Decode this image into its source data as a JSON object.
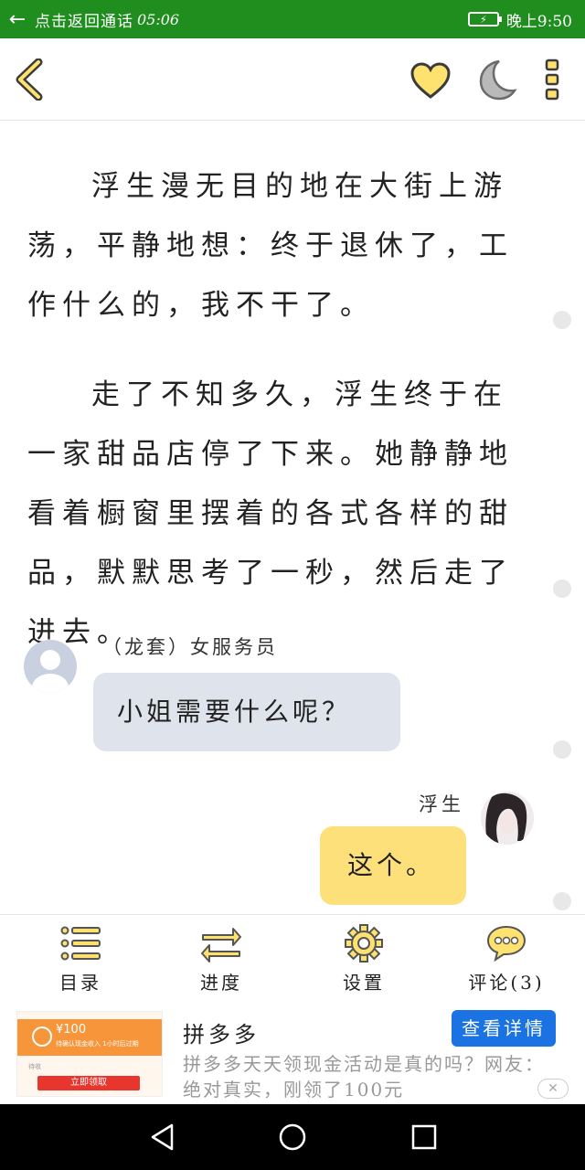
{
  "status_bar": {
    "return_hint": "点击返回通话",
    "call_time": "05:06",
    "clock": "晚上9:50",
    "background_color": "#1f8e1f"
  },
  "toolbar": {
    "icons": [
      "back-chevron-icon",
      "heart-icon",
      "moon-icon",
      "more-vertical-icon"
    ],
    "accent_color": "#fde26f"
  },
  "story": {
    "paragraphs": [
      "浮生漫无目的地在大街上游荡，平静地想：终于退休了，工作什么的，我不干了。",
      "走了不知多久，浮生终于在一家甜品店停了下来。她静静地看着橱窗里摆着的各式各样的甜品，默默思考了一秒，然后走了进去。"
    ]
  },
  "chat": {
    "left": {
      "name": "（龙套）女服务员",
      "message": "小姐需要什么呢？"
    },
    "right": {
      "name": "浮生",
      "message": "这个。"
    }
  },
  "bottom_menu": {
    "items": [
      {
        "label": "目录",
        "icon": "list-icon"
      },
      {
        "label": "进度",
        "icon": "swap-arrows-icon"
      },
      {
        "label": "设置",
        "icon": "gear-icon"
      },
      {
        "label": "评论(3)",
        "icon": "comment-bubble-icon"
      }
    ]
  },
  "ad": {
    "image": {
      "amount": "¥100",
      "subtitle": "待确认现金收入 1小时后过期",
      "note": "待收",
      "button": "立即领取"
    },
    "title": "拼多多",
    "description": "拼多多天天领现金活动是真的吗？网友：绝对真实，刚领了100元",
    "cta": "查看详情",
    "close": "✕",
    "cta_color": "#1b73e3"
  },
  "nav_bar": {
    "icons": [
      "back-triangle-icon",
      "home-circle-icon",
      "recent-square-icon"
    ]
  }
}
